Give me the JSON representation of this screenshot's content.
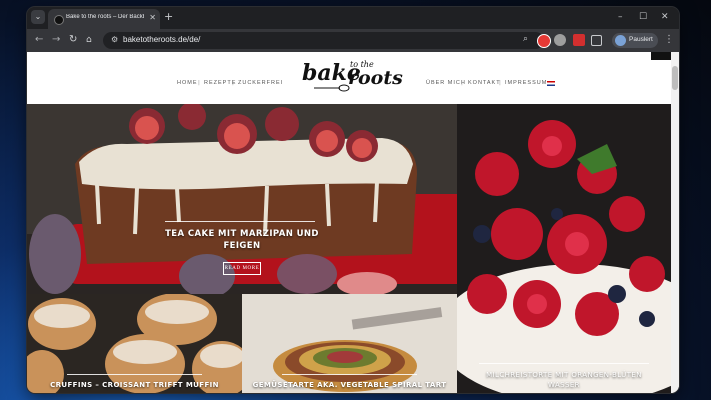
{
  "browser": {
    "tab_title": "Bake to the roots – Der Backblog aus",
    "url": "baketotheroots.de/de/",
    "profile_name": "Pauslert",
    "icons": {
      "tab_search": "chevron-down-icon",
      "new_tab": "plus-icon",
      "minimize": "minimize-icon",
      "maximize": "maximize-icon",
      "close": "close-icon",
      "back": "back-arrow-icon",
      "forward": "forward-arrow-icon",
      "reload": "reload-icon",
      "home": "home-icon",
      "site_info": "site-settings-icon",
      "zoom": "zoom-icon",
      "bookmark": "star-icon",
      "menu": "kebab-menu-icon"
    }
  },
  "site": {
    "logo_text": "bake to the roots",
    "nav_left": [
      "HOME",
      "REZEPTE",
      "ZUCKERFREI"
    ],
    "nav_right": [
      "ÜBER MICH",
      "KONTAKT",
      "IMPRESSUM"
    ],
    "separator": "|"
  },
  "posts": {
    "featured": {
      "title_line1": "TEA CAKE MIT MARZIPAN UND",
      "title_line2": "FEIGEN",
      "more_label": "READ MORE"
    },
    "berries": {
      "title_line1": "MILCHREISTORTE MIT ORANGEN-BLÜTEN",
      "title_line2": "WASSER"
    },
    "cruffins": {
      "title": "CRUFFINS – CROISSANT TRIFFT MUFFIN"
    },
    "tart": {
      "title": "GEMÜSETARTE AKA. VEGETABLE SPIRAL TART"
    }
  },
  "colors": {
    "browser_frame": "#1f2023",
    "toolbar": "#35363a",
    "accent_red": "#c8102e"
  }
}
